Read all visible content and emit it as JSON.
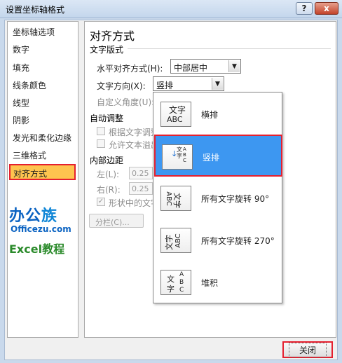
{
  "window": {
    "title": "设置坐标轴格式",
    "help_label": "?",
    "close_label": "x"
  },
  "nav": {
    "items": [
      "坐标轴选项",
      "数字",
      "填充",
      "线条颜色",
      "线型",
      "阴影",
      "发光和柔化边缘",
      "三维格式",
      "对齐方式"
    ],
    "selected_index": 8
  },
  "logo": {
    "main_part1": "办公",
    "main_part2": "族",
    "site": "Officezu.com",
    "excel": "Excel教程"
  },
  "panel": {
    "title": "对齐方式",
    "text_layout": {
      "heading": "文字版式",
      "halign_label": "水平对齐方式(H):",
      "halign_value": "中部居中",
      "direction_label": "文字方向(X):",
      "direction_value": "竖排",
      "custom_angle_label": "自定义角度(U):"
    },
    "autofit": {
      "heading": "自动调整",
      "resize_label": "根据文字调整",
      "overflow_label": "允许文本溢出"
    },
    "margins": {
      "heading": "内部边距",
      "left_label": "左(L):",
      "left_value": "0.25",
      "right_label": "右(R):",
      "right_value": "0.25",
      "wrap_label": "形状中的文字"
    },
    "columns_button": "分栏(C)..."
  },
  "dropdown": {
    "options": [
      {
        "label": "横排",
        "icon": "horizontal-text-icon",
        "icon_line1": "文字",
        "icon_line2": "ABC"
      },
      {
        "label": "竖排",
        "icon": "stacked-vertical-text-icon",
        "icon_col1": "文字",
        "icon_col2": "ABC"
      },
      {
        "label": "所有文字旋转 90°",
        "icon": "rotate-90-text-icon",
        "icon_line1": "文字",
        "icon_line2": "ABC"
      },
      {
        "label": "所有文字旋转 270°",
        "icon": "rotate-270-text-icon",
        "icon_line1": "文字",
        "icon_line2": "ABC"
      },
      {
        "label": "堆积",
        "icon": "stacked-text-icon",
        "icon_line1": "文",
        "icon_line2": "字",
        "icon_letters": [
          "A",
          "B",
          "C"
        ]
      }
    ],
    "highlighted_index": 1
  },
  "footer": {
    "close_button": "关闭"
  },
  "colors": {
    "selection_highlight": "#fec44f",
    "dropdown_highlight": "#3d97f1",
    "annotation_border": "#e5202f"
  }
}
